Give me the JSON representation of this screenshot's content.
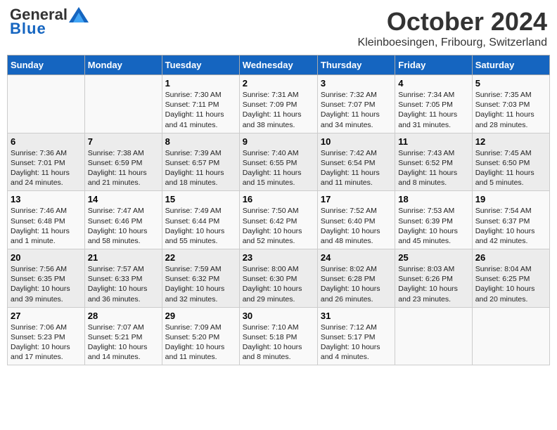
{
  "header": {
    "logo_general": "General",
    "logo_blue": "Blue",
    "month": "October 2024",
    "location": "Kleinboesingen, Fribourg, Switzerland"
  },
  "days_of_week": [
    "Sunday",
    "Monday",
    "Tuesday",
    "Wednesday",
    "Thursday",
    "Friday",
    "Saturday"
  ],
  "weeks": [
    [
      {
        "day": "",
        "detail": ""
      },
      {
        "day": "",
        "detail": ""
      },
      {
        "day": "1",
        "detail": "Sunrise: 7:30 AM\nSunset: 7:11 PM\nDaylight: 11 hours and 41 minutes."
      },
      {
        "day": "2",
        "detail": "Sunrise: 7:31 AM\nSunset: 7:09 PM\nDaylight: 11 hours and 38 minutes."
      },
      {
        "day": "3",
        "detail": "Sunrise: 7:32 AM\nSunset: 7:07 PM\nDaylight: 11 hours and 34 minutes."
      },
      {
        "day": "4",
        "detail": "Sunrise: 7:34 AM\nSunset: 7:05 PM\nDaylight: 11 hours and 31 minutes."
      },
      {
        "day": "5",
        "detail": "Sunrise: 7:35 AM\nSunset: 7:03 PM\nDaylight: 11 hours and 28 minutes."
      }
    ],
    [
      {
        "day": "6",
        "detail": "Sunrise: 7:36 AM\nSunset: 7:01 PM\nDaylight: 11 hours and 24 minutes."
      },
      {
        "day": "7",
        "detail": "Sunrise: 7:38 AM\nSunset: 6:59 PM\nDaylight: 11 hours and 21 minutes."
      },
      {
        "day": "8",
        "detail": "Sunrise: 7:39 AM\nSunset: 6:57 PM\nDaylight: 11 hours and 18 minutes."
      },
      {
        "day": "9",
        "detail": "Sunrise: 7:40 AM\nSunset: 6:55 PM\nDaylight: 11 hours and 15 minutes."
      },
      {
        "day": "10",
        "detail": "Sunrise: 7:42 AM\nSunset: 6:54 PM\nDaylight: 11 hours and 11 minutes."
      },
      {
        "day": "11",
        "detail": "Sunrise: 7:43 AM\nSunset: 6:52 PM\nDaylight: 11 hours and 8 minutes."
      },
      {
        "day": "12",
        "detail": "Sunrise: 7:45 AM\nSunset: 6:50 PM\nDaylight: 11 hours and 5 minutes."
      }
    ],
    [
      {
        "day": "13",
        "detail": "Sunrise: 7:46 AM\nSunset: 6:48 PM\nDaylight: 11 hours and 1 minute."
      },
      {
        "day": "14",
        "detail": "Sunrise: 7:47 AM\nSunset: 6:46 PM\nDaylight: 10 hours and 58 minutes."
      },
      {
        "day": "15",
        "detail": "Sunrise: 7:49 AM\nSunset: 6:44 PM\nDaylight: 10 hours and 55 minutes."
      },
      {
        "day": "16",
        "detail": "Sunrise: 7:50 AM\nSunset: 6:42 PM\nDaylight: 10 hours and 52 minutes."
      },
      {
        "day": "17",
        "detail": "Sunrise: 7:52 AM\nSunset: 6:40 PM\nDaylight: 10 hours and 48 minutes."
      },
      {
        "day": "18",
        "detail": "Sunrise: 7:53 AM\nSunset: 6:39 PM\nDaylight: 10 hours and 45 minutes."
      },
      {
        "day": "19",
        "detail": "Sunrise: 7:54 AM\nSunset: 6:37 PM\nDaylight: 10 hours and 42 minutes."
      }
    ],
    [
      {
        "day": "20",
        "detail": "Sunrise: 7:56 AM\nSunset: 6:35 PM\nDaylight: 10 hours and 39 minutes."
      },
      {
        "day": "21",
        "detail": "Sunrise: 7:57 AM\nSunset: 6:33 PM\nDaylight: 10 hours and 36 minutes."
      },
      {
        "day": "22",
        "detail": "Sunrise: 7:59 AM\nSunset: 6:32 PM\nDaylight: 10 hours and 32 minutes."
      },
      {
        "day": "23",
        "detail": "Sunrise: 8:00 AM\nSunset: 6:30 PM\nDaylight: 10 hours and 29 minutes."
      },
      {
        "day": "24",
        "detail": "Sunrise: 8:02 AM\nSunset: 6:28 PM\nDaylight: 10 hours and 26 minutes."
      },
      {
        "day": "25",
        "detail": "Sunrise: 8:03 AM\nSunset: 6:26 PM\nDaylight: 10 hours and 23 minutes."
      },
      {
        "day": "26",
        "detail": "Sunrise: 8:04 AM\nSunset: 6:25 PM\nDaylight: 10 hours and 20 minutes."
      }
    ],
    [
      {
        "day": "27",
        "detail": "Sunrise: 7:06 AM\nSunset: 5:23 PM\nDaylight: 10 hours and 17 minutes."
      },
      {
        "day": "28",
        "detail": "Sunrise: 7:07 AM\nSunset: 5:21 PM\nDaylight: 10 hours and 14 minutes."
      },
      {
        "day": "29",
        "detail": "Sunrise: 7:09 AM\nSunset: 5:20 PM\nDaylight: 10 hours and 11 minutes."
      },
      {
        "day": "30",
        "detail": "Sunrise: 7:10 AM\nSunset: 5:18 PM\nDaylight: 10 hours and 8 minutes."
      },
      {
        "day": "31",
        "detail": "Sunrise: 7:12 AM\nSunset: 5:17 PM\nDaylight: 10 hours and 4 minutes."
      },
      {
        "day": "",
        "detail": ""
      },
      {
        "day": "",
        "detail": ""
      }
    ]
  ]
}
